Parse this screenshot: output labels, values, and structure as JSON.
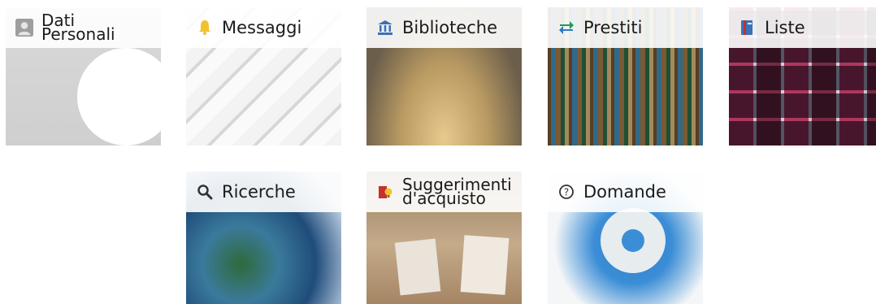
{
  "tiles": [
    {
      "id": "dati-personali",
      "label_lines": [
        "Dati",
        "Personali"
      ],
      "icon": "user-avatar-icon"
    },
    {
      "id": "messaggi",
      "label": "Messaggi",
      "icon": "bell-icon"
    },
    {
      "id": "biblioteche",
      "label": "Biblioteche",
      "icon": "library-building-icon"
    },
    {
      "id": "prestiti",
      "label": "Prestiti",
      "icon": "swap-arrows-icon"
    },
    {
      "id": "liste",
      "label": "Liste",
      "icon": "list-book-icon"
    },
    {
      "id": "ricerche",
      "label": "Ricerche",
      "icon": "search-icon"
    },
    {
      "id": "suggerimenti",
      "label_lines": [
        "Suggerimenti",
        "d'acquisto"
      ],
      "icon": "suggestion-bulb-icon"
    },
    {
      "id": "domande",
      "label": "Domande",
      "icon": "question-circle-icon"
    }
  ]
}
